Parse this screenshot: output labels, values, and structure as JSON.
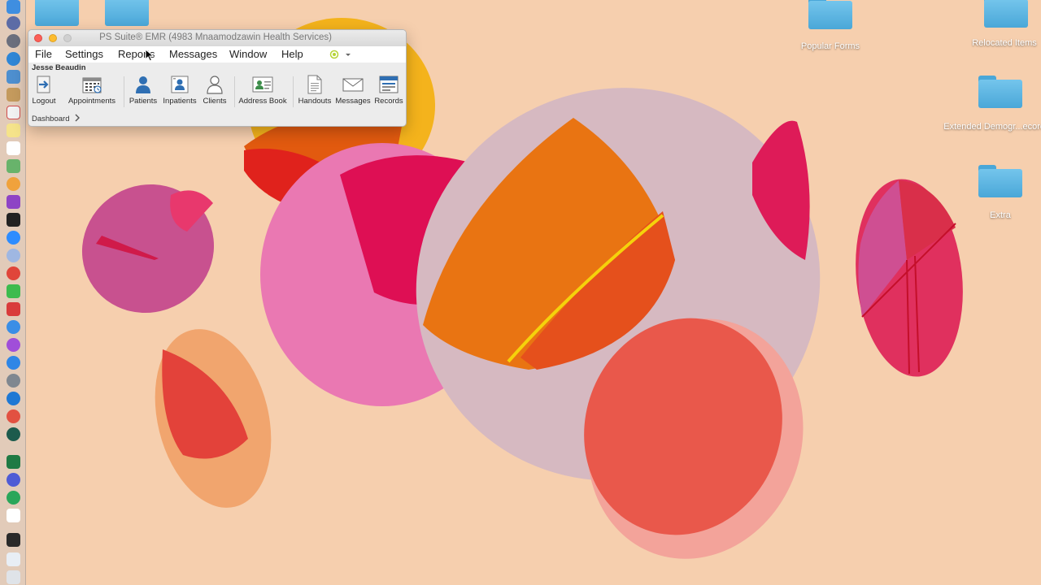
{
  "window": {
    "title": "PS Suite® EMR   (4983 Mnaamodzawin Health Services)"
  },
  "menu": {
    "items": [
      "File",
      "Settings",
      "Reports",
      "Messages",
      "Window",
      "Help"
    ]
  },
  "user": {
    "name": "Jesse Beaudin"
  },
  "toolbar": {
    "items": [
      {
        "label": "Logout",
        "icon": "logout-icon"
      },
      {
        "label": "Appointments",
        "icon": "calendar-icon"
      },
      {
        "label": "Patients",
        "icon": "patient-icon"
      },
      {
        "label": "Inpatients",
        "icon": "inpatient-icon"
      },
      {
        "label": "Clients",
        "icon": "client-icon"
      },
      {
        "label": "Address Book",
        "icon": "address-book-icon"
      },
      {
        "label": "Handouts",
        "icon": "document-icon"
      },
      {
        "label": "Messages",
        "icon": "envelope-icon"
      },
      {
        "label": "Records",
        "icon": "records-icon"
      }
    ]
  },
  "breadcrumb": {
    "label": "Dashboard"
  },
  "desktop": {
    "icons": [
      {
        "label": "Popular Forms"
      },
      {
        "label": "Relocated Items"
      },
      {
        "label": "Extended Demogr...ecording"
      },
      {
        "label": "Extra"
      }
    ]
  },
  "colors": {
    "wallpaper": "#f6cfae",
    "folder": "#5db6e4",
    "close": "#fc5f57",
    "minimize": "#fdbc2e",
    "accent": "#2f6fb3"
  }
}
